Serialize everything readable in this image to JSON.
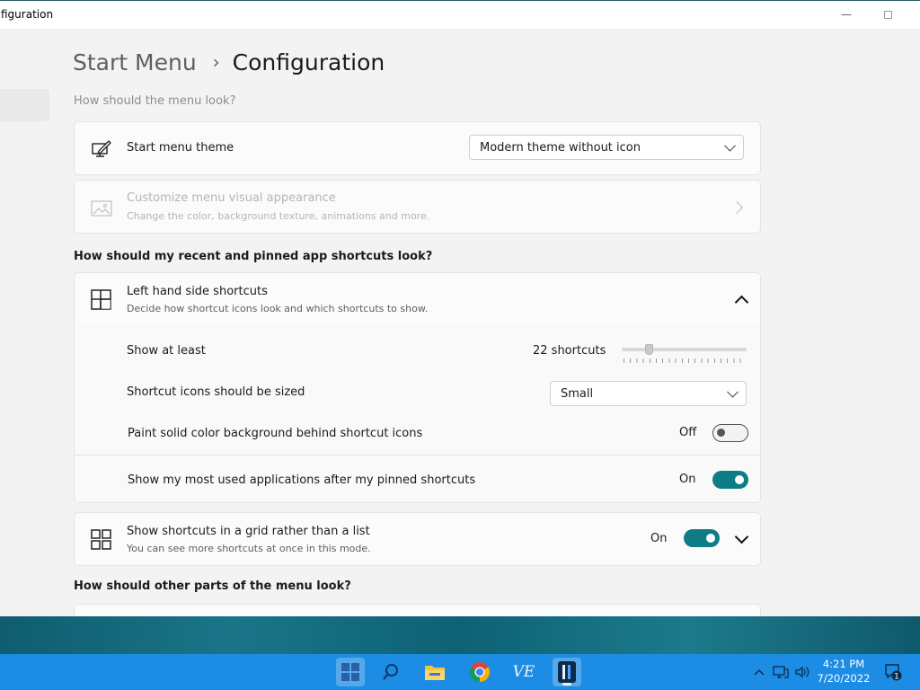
{
  "window": {
    "title": "figuration"
  },
  "breadcrumb": {
    "parent": "Start Menu",
    "separator": "›",
    "current": "Configuration"
  },
  "sections": {
    "menu_look": "How should the menu look?",
    "shortcuts_look": "How should my recent and pinned app shortcuts look?",
    "other_parts": "How should other parts of the menu look?"
  },
  "theme_card": {
    "label": "Start menu theme",
    "icon": "pen-monitor-icon",
    "dropdown_value": "Modern theme without icon"
  },
  "visual_card": {
    "label": "Customize menu visual appearance",
    "sub": "Change the color, background texture, animations and more.",
    "icon": "image-icon",
    "enabled": false
  },
  "left_shortcuts": {
    "label": "Left hand side shortcuts",
    "sub": "Decide how shortcut icons look and which shortcuts to show.",
    "icon": "layout-icon",
    "expanded": true,
    "show_at_least": {
      "label": "Show at least",
      "value_text": "22 shortcuts",
      "slider_fraction": 0.2
    },
    "icon_size": {
      "label": "Shortcut icons should be sized",
      "value": "Small"
    },
    "paint_bg": {
      "label": "Paint solid color background behind shortcut icons",
      "state": "Off"
    },
    "most_used": {
      "label": "Show my most used applications after my pinned shortcuts",
      "state": "On"
    }
  },
  "grid_card": {
    "label": "Show shortcuts in a grid rather than a list",
    "sub": "You can see more shortcuts at once in this mode.",
    "icon": "grid-icon",
    "state": "On",
    "expanded": false
  },
  "taskbar": {
    "apps": [
      "start-icon",
      "search-icon",
      "file-explorer-icon",
      "chrome-icon",
      "ve-app-icon",
      "config-app-icon"
    ],
    "ve_label": "VE",
    "clock_time": "4:21 PM",
    "clock_date": "7/20/2022",
    "notification_count": "1"
  },
  "colors": {
    "accent": "#0e7c86",
    "taskbar": "#1c8ce5"
  }
}
